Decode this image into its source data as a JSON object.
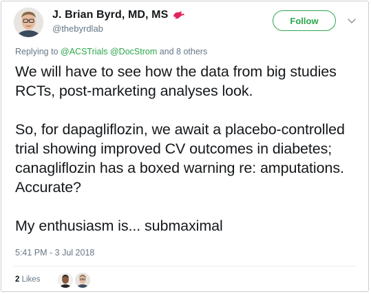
{
  "author": {
    "display_name": "J. Brian Byrd, MD, MS",
    "handle": "@thebyrdlab",
    "badge_icon": "red-bird-icon"
  },
  "follow_button": {
    "label": "Follow"
  },
  "menu": {
    "icon": "chevron-down-icon"
  },
  "reply_context": {
    "prefix": "Replying to ",
    "mentions": [
      "@ACSTrials",
      "@DocStrom"
    ],
    "suffix": " and 8 others"
  },
  "tweet": {
    "paragraphs": [
      "We will have to see how the data from big studies RCTs, post-marketing analyses look.",
      "So, for dapagliflozin, we await a placebo-controlled trial showing improved CV outcomes in diabetes; canagliflozin has a boxed warning re: amputations. Accurate?",
      "My enthusiasm is... submaximal"
    ],
    "timestamp": "5:41 PM - 3 Jul 2018"
  },
  "engagement": {
    "likes_count": "2",
    "likes_label": "Likes"
  },
  "colors": {
    "accent": "#2aa64a",
    "secondary_text": "#657786",
    "primary_text": "#14171a",
    "badge": "#e0245e"
  }
}
